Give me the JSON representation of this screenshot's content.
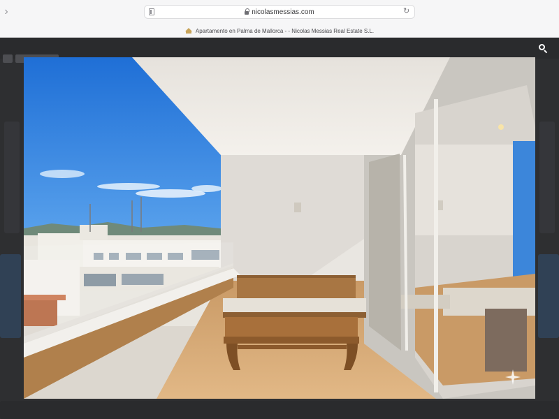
{
  "browser": {
    "url": "nicolasmessias.com",
    "tab_title": "Apartamento en Palma de Mallorca - - Nicolas Messias Real Estate S.L.",
    "favicon": "house-icon",
    "back_icon": "chevron-left-icon",
    "reload_icon": "reload-icon",
    "tab_icon": "book-icon"
  },
  "lightbox": {
    "image_alt": "",
    "search_icon": "search-icon",
    "overlay_icon": "sparkle-icon"
  },
  "colors": {
    "sky": "#2f7fe0",
    "wall": "#e9e6e1",
    "wood": "#b07a44",
    "overlay": "#2e2f31"
  }
}
